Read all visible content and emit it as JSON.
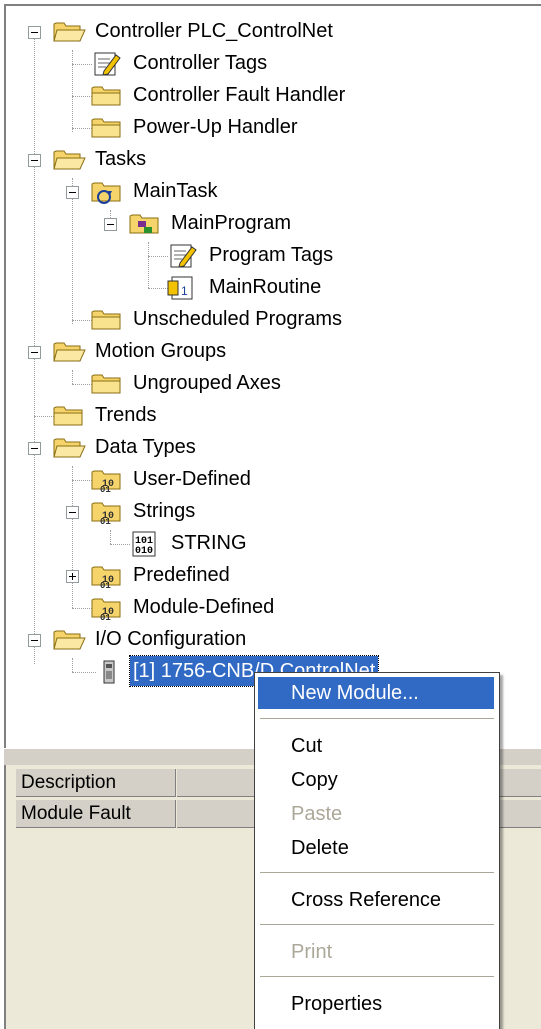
{
  "tree": {
    "controller": "Controller PLC_ControlNet",
    "controller_tags": "Controller Tags",
    "controller_fault_handler": "Controller Fault Handler",
    "power_up_handler": "Power-Up Handler",
    "tasks": "Tasks",
    "main_task": "MainTask",
    "main_program": "MainProgram",
    "program_tags": "Program Tags",
    "main_routine": "MainRoutine",
    "unscheduled_programs": "Unscheduled Programs",
    "motion_groups": "Motion Groups",
    "ungrouped_axes": "Ungrouped Axes",
    "trends": "Trends",
    "data_types": "Data Types",
    "user_defined": "User-Defined",
    "strings": "Strings",
    "string": "STRING",
    "predefined": "Predefined",
    "module_defined": "Module-Defined",
    "io_configuration": "I/O Configuration",
    "module": "[1] 1756-CNB/D ControlNet"
  },
  "properties": {
    "description_label": "Description",
    "module_fault_label": "Module Fault"
  },
  "context_menu": {
    "new_module": "New Module...",
    "cut": "Cut",
    "copy": "Copy",
    "paste": "Paste",
    "delete": "Delete",
    "cross_reference": "Cross Reference",
    "print": "Print",
    "properties": "Properties"
  },
  "colors": {
    "selection": "#316ac5",
    "folder": "#f5d56b",
    "disabled_text": "#aca899"
  }
}
